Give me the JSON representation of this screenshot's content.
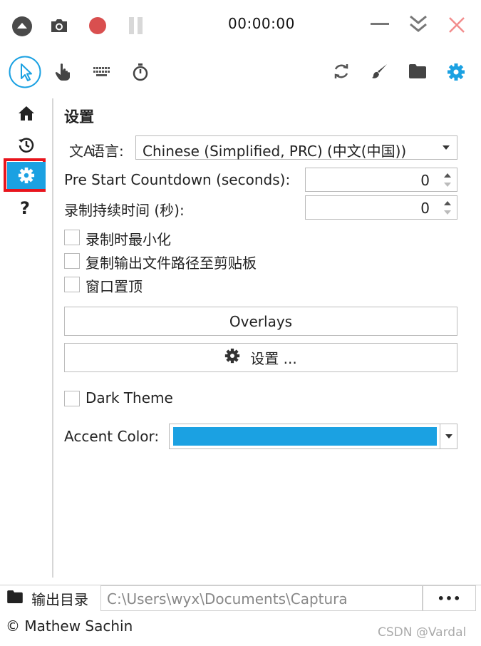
{
  "titlebar": {
    "timer": "00:00:00"
  },
  "settings": {
    "title": "设置",
    "language_label": "语言:",
    "language_value": "Chinese (Simplified, PRC) (中文(中国))",
    "countdown_label": "Pre Start Countdown (seconds):",
    "countdown_value": "0",
    "duration_label": "录制持续时间 (秒):",
    "duration_value": "0",
    "checkboxes": [
      "录制时最小化",
      "复制输出文件路径至剪贴板",
      "窗口置顶"
    ],
    "overlays_label": "Overlays",
    "settings_button_label": "设置 ...",
    "dark_theme_label": "Dark Theme",
    "accent_label": "Accent Color:",
    "accent_color": "#1ba1e2"
  },
  "footer": {
    "output_label": "输出目录",
    "output_path": "C:\\Users\\wyx\\Documents\\Captura",
    "more_label": "•••",
    "copyright": "© Mathew Sachin",
    "watermark": "CSDN @Vardal"
  },
  "colors": {
    "accent": "#1ba1e2",
    "highlight": "#e8151d"
  }
}
